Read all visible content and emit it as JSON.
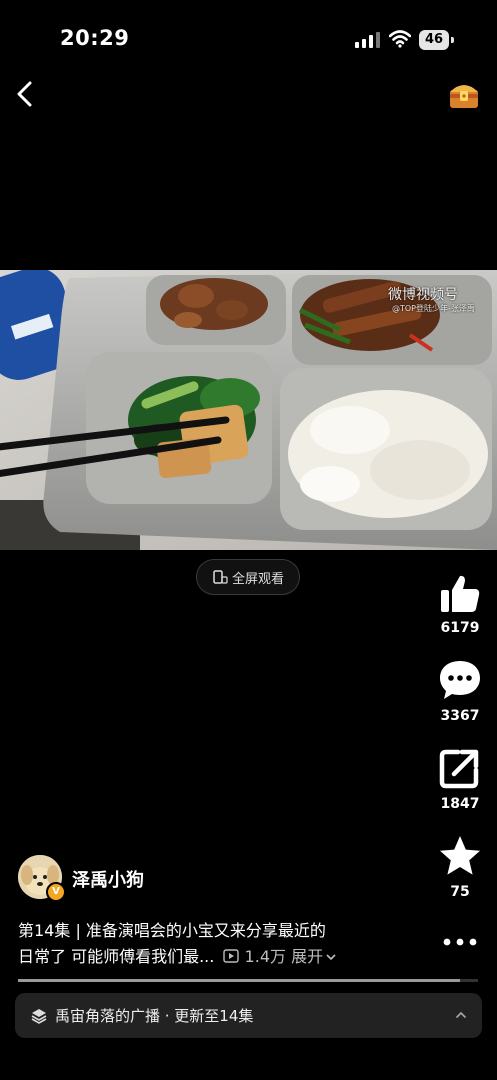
{
  "status_bar": {
    "time": "20:29",
    "battery": "46"
  },
  "video": {
    "watermark": "微博视频号",
    "watermark_sub": "@TOP登陆少年-张泽禹",
    "fullscreen_label": "全屏观看"
  },
  "actions": {
    "like_count": "6179",
    "comment_count": "3367",
    "share_count": "1847",
    "favorite_count": "75"
  },
  "author": {
    "name": "泽禹小狗",
    "badge": "V"
  },
  "description": {
    "line1": "第14集 | 准备演唱会的小宝又来分享最近的",
    "line2": "日常了 可能师傅看我们最...",
    "views": "1.4万",
    "expand": "展开"
  },
  "progress": 0.96,
  "series_bar": {
    "label": "禹宙角落的广播 · 更新至14集"
  },
  "icons": {
    "back": "chevron-left-icon",
    "chest": "treasure-chest-icon",
    "like": "thumbs-up-icon",
    "comment": "comment-bubble-icon",
    "share": "share-icon",
    "favorite": "star-icon",
    "more": "more-dots-icon"
  },
  "colors": {
    "background": "#000000",
    "accent_chest": "#e8a33a",
    "verified": "#f5a623"
  }
}
